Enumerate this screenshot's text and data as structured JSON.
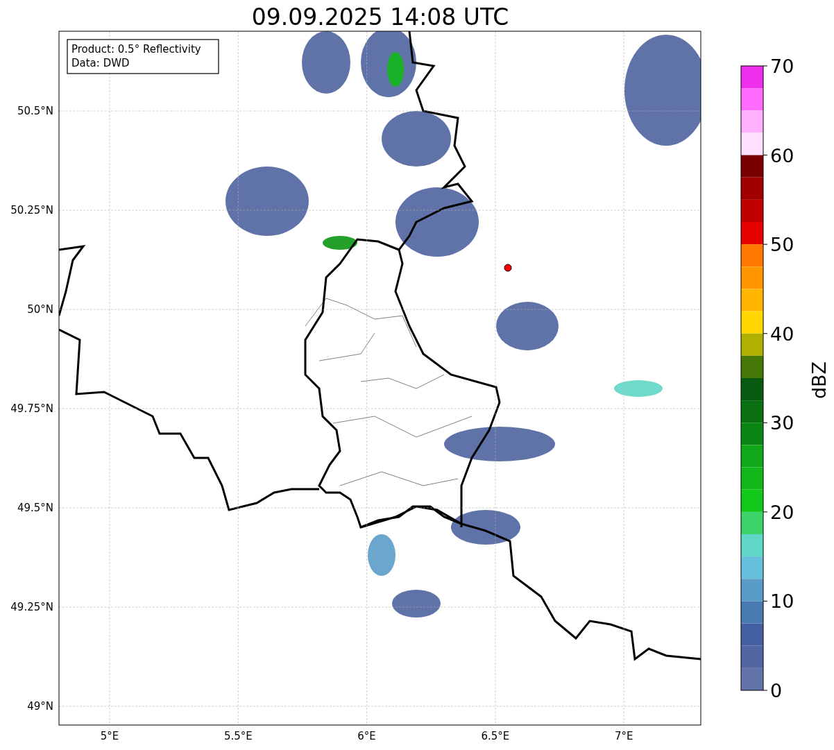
{
  "title": "09.09.2025 14:08 UTC",
  "map": {
    "info_box": [
      "Product: 0.5° Reflectivity",
      "Data: DWD"
    ],
    "y_ticks": [
      "50.5°N",
      "50.25°N",
      "50°N",
      "49.75°N",
      "49.5°N",
      "49.25°N",
      "49°N"
    ],
    "x_ticks": [
      "5°E",
      "5.5°E",
      "6°E",
      "6.5°E",
      "7°E"
    ]
  },
  "colorbar": {
    "label": "dBZ",
    "ticks": [
      "70",
      "60",
      "50",
      "40",
      "30",
      "20",
      "10",
      "0"
    ],
    "bins": [
      {
        "color": "#ee30ee"
      },
      {
        "color": "#ff6cff"
      },
      {
        "color": "#ffb0ff"
      },
      {
        "color": "#ffe0ff"
      },
      {
        "color": "#7a0000"
      },
      {
        "color": "#a00000"
      },
      {
        "color": "#c00000"
      },
      {
        "color": "#e60000"
      },
      {
        "color": "#ff7800"
      },
      {
        "color": "#ff9600"
      },
      {
        "color": "#ffb400"
      },
      {
        "color": "#ffd700"
      },
      {
        "color": "#b0b000"
      },
      {
        "color": "#467808"
      },
      {
        "color": "#085a10"
      },
      {
        "color": "#0a7012"
      },
      {
        "color": "#0b8614"
      },
      {
        "color": "#10a818"
      },
      {
        "color": "#12b81a"
      },
      {
        "color": "#12c818"
      },
      {
        "color": "#3cd46a"
      },
      {
        "color": "#60d6c6"
      },
      {
        "color": "#66c0dc"
      },
      {
        "color": "#5a9cc8"
      },
      {
        "color": "#4a7ab2"
      },
      {
        "color": "#4460a2"
      },
      {
        "color": "#5266a2"
      },
      {
        "color": "#6374a8"
      }
    ]
  }
}
